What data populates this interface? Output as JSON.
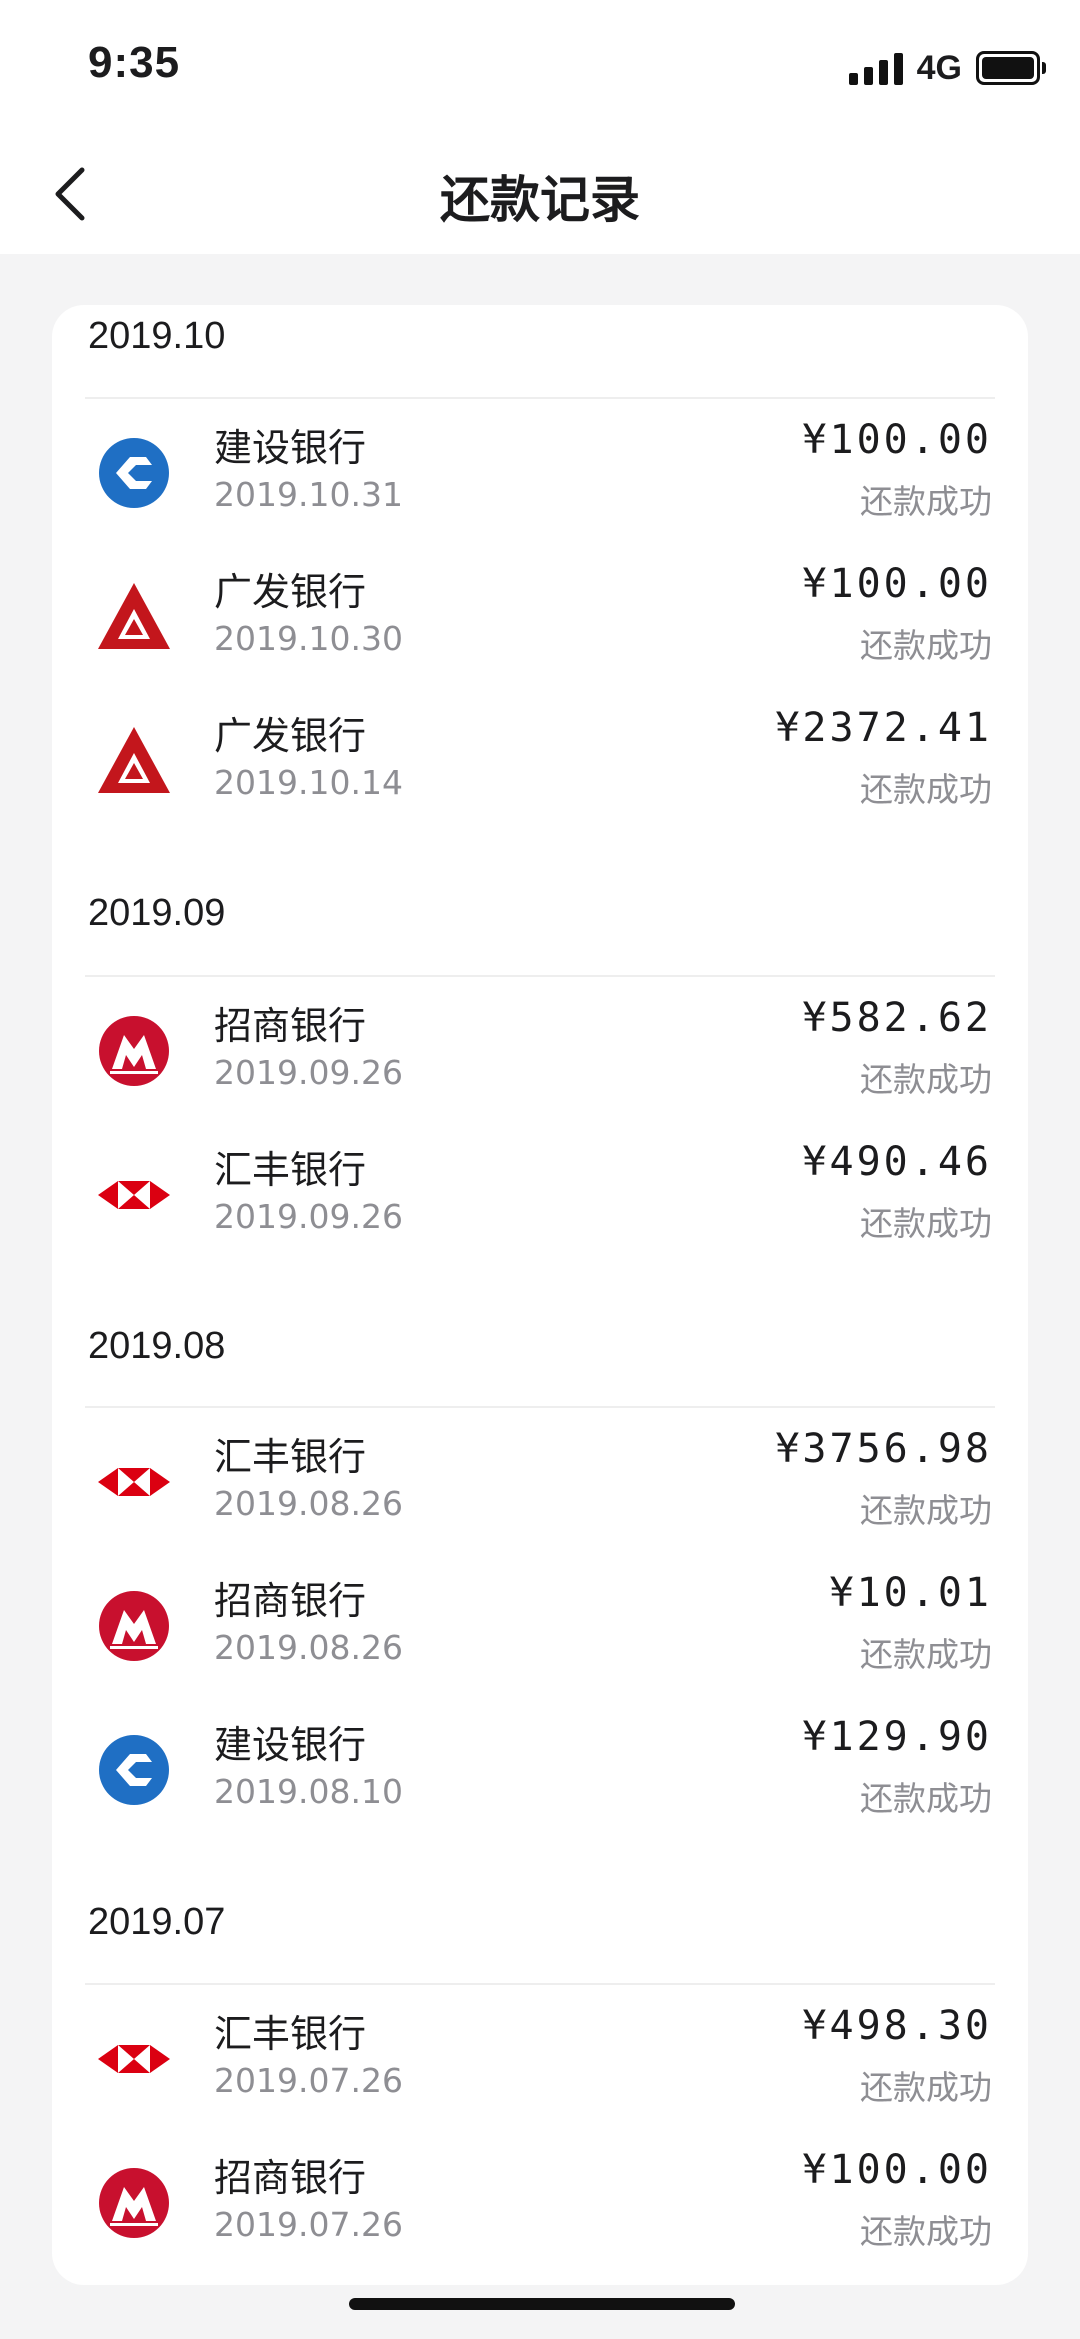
{
  "status_bar": {
    "time": "9:35",
    "network": "4G"
  },
  "header": {
    "title": "还款记录"
  },
  "groups": [
    {
      "month": "2019.10",
      "records": [
        {
          "bank": "建设银行",
          "date": "2019.10.31",
          "amount": "¥100.00",
          "status": "还款成功",
          "logo": "ccb-logo"
        },
        {
          "bank": "广发银行",
          "date": "2019.10.30",
          "amount": "¥100.00",
          "status": "还款成功",
          "logo": "cgb-logo"
        },
        {
          "bank": "广发银行",
          "date": "2019.10.14",
          "amount": "¥2372.41",
          "status": "还款成功",
          "logo": "cgb-logo"
        }
      ]
    },
    {
      "month": "2019.09",
      "records": [
        {
          "bank": "招商银行",
          "date": "2019.09.26",
          "amount": "¥582.62",
          "status": "还款成功",
          "logo": "cmb-logo"
        },
        {
          "bank": "汇丰银行",
          "date": "2019.09.26",
          "amount": "¥490.46",
          "status": "还款成功",
          "logo": "hsbc-logo"
        }
      ]
    },
    {
      "month": "2019.08",
      "records": [
        {
          "bank": "汇丰银行",
          "date": "2019.08.26",
          "amount": "¥3756.98",
          "status": "还款成功",
          "logo": "hsbc-logo"
        },
        {
          "bank": "招商银行",
          "date": "2019.08.26",
          "amount": "¥10.01",
          "status": "还款成功",
          "logo": "cmb-logo"
        },
        {
          "bank": "建设银行",
          "date": "2019.08.10",
          "amount": "¥129.90",
          "status": "还款成功",
          "logo": "ccb-logo"
        }
      ]
    },
    {
      "month": "2019.07",
      "records": [
        {
          "bank": "汇丰银行",
          "date": "2019.07.26",
          "amount": "¥498.30",
          "status": "还款成功",
          "logo": "hsbc-logo"
        },
        {
          "bank": "招商银行",
          "date": "2019.07.26",
          "amount": "¥100.00",
          "status": "还款成功",
          "logo": "cmb-logo"
        }
      ]
    }
  ],
  "colors": {
    "ccb_blue": "#1f6fc4",
    "cgb_red": "#c3161c",
    "cmb_red": "#c8102e",
    "hsbc_red": "#db0011",
    "secondary_text": "#8e8e93"
  }
}
